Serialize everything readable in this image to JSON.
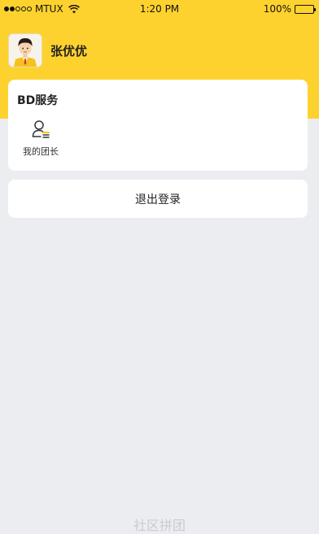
{
  "status_bar": {
    "carrier": "MTUX",
    "time": "1:20 PM",
    "battery": "100%",
    "signal_icon": "signal-dots-icon",
    "wifi_icon": "wifi-icon",
    "battery_icon": "battery-icon"
  },
  "profile": {
    "name": "张优优",
    "avatar_icon": "cartoon-avatar"
  },
  "bd_service": {
    "title": "BD服务",
    "items": [
      {
        "label": "我的团长",
        "icon": "person-list-icon"
      }
    ]
  },
  "logout": {
    "label": "退出登录"
  },
  "footer": {
    "text": "社区拼团"
  },
  "colors": {
    "header_yellow": "#fed22e",
    "page_background": "#ebedf1",
    "card_background": "#ffffff"
  }
}
